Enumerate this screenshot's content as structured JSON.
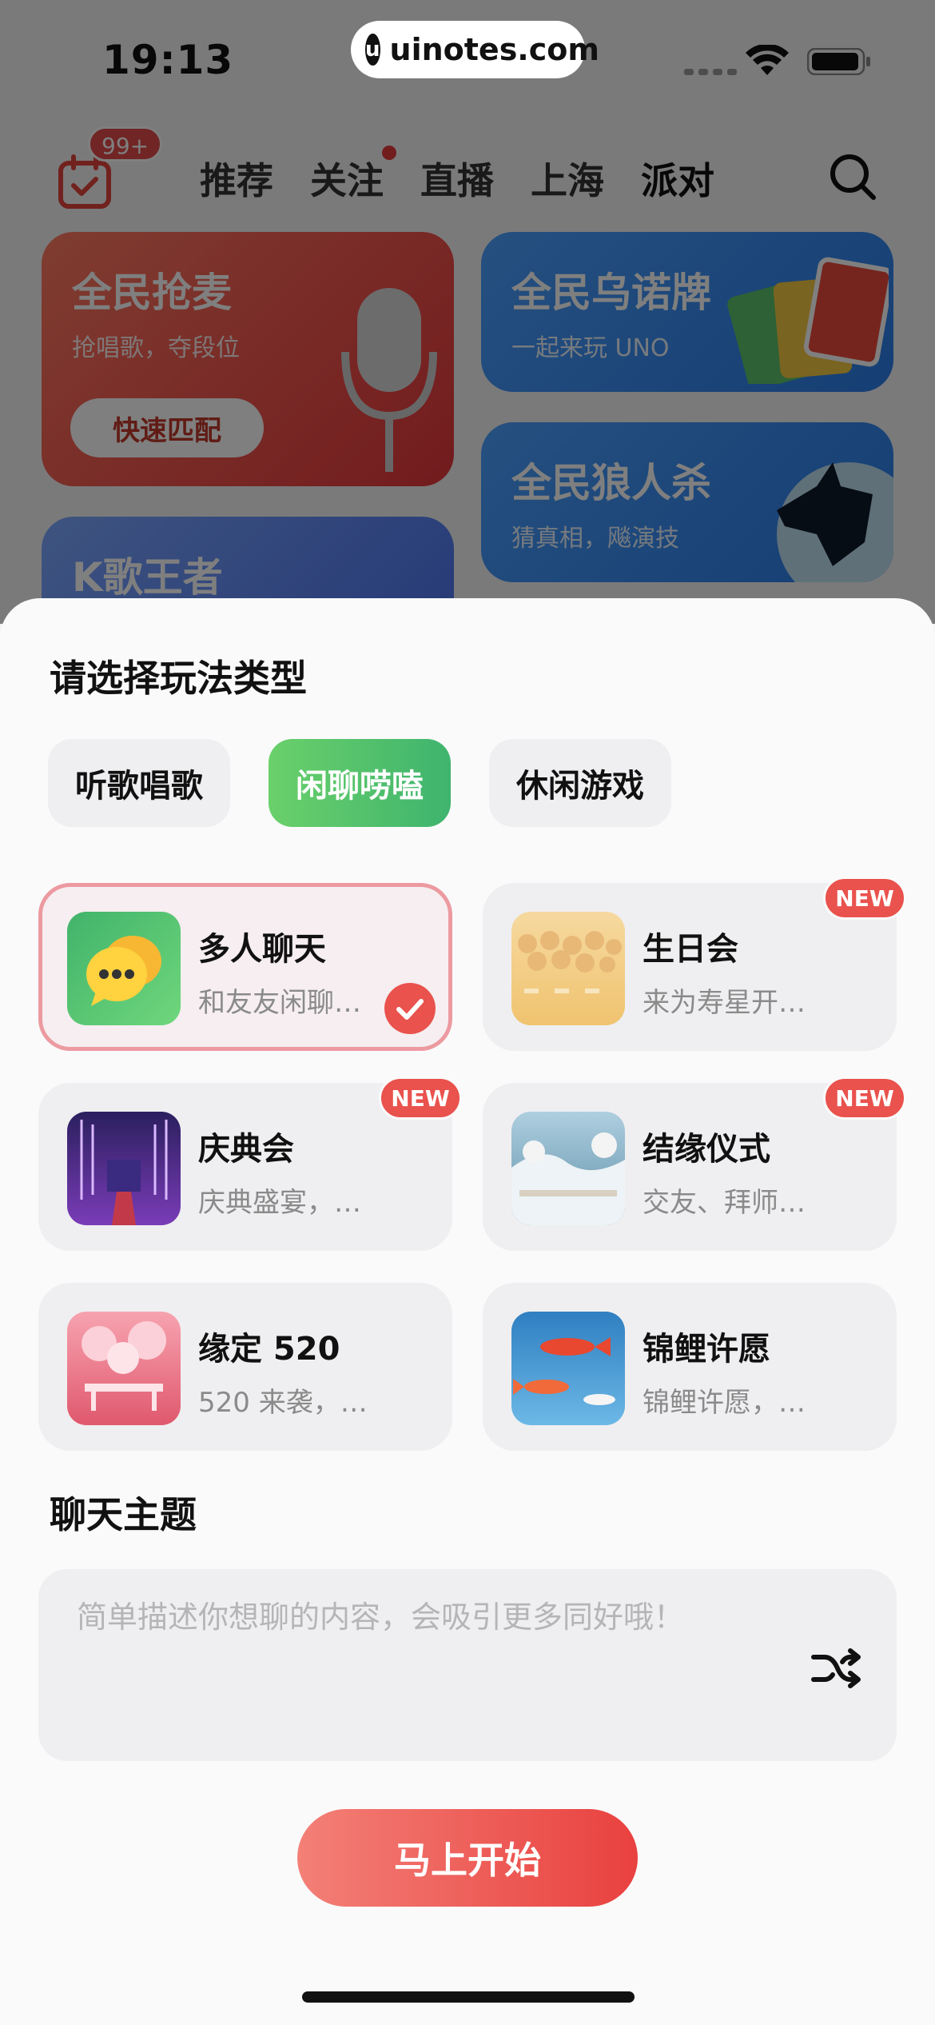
{
  "status_bar": {
    "time": "19:13",
    "watermark": "uinotes.com",
    "watermark_logo": "u"
  },
  "nav": {
    "badge": "99+",
    "tabs": [
      {
        "label": "推荐",
        "dot": false
      },
      {
        "label": "关注",
        "dot": true
      },
      {
        "label": "直播",
        "dot": false
      },
      {
        "label": "上海",
        "dot": false
      },
      {
        "label": "派对",
        "dot": false,
        "active": true
      }
    ]
  },
  "background_cards": {
    "card_a": {
      "title": "全民抢麦",
      "subtitle": "抢唱歌，夺段位",
      "button": "快速匹配"
    },
    "card_b": {
      "title": "全民乌诺牌",
      "subtitle": "一起来玩 UNO"
    },
    "card_c": {
      "title": "全民狼人杀",
      "subtitle": "猜真相，飚演技"
    },
    "card_d": {
      "title": "K歌王者"
    }
  },
  "sheet": {
    "title": "请选择玩法类型",
    "types": [
      {
        "label": "听歌唱歌",
        "active": false
      },
      {
        "label": "闲聊唠嗑",
        "active": true
      },
      {
        "label": "休闲游戏",
        "active": false
      }
    ],
    "modes": [
      {
        "name": "多人聊天",
        "desc": "和友友闲聊…",
        "new": false,
        "selected": true,
        "icon": "chat-bubbles-icon"
      },
      {
        "name": "生日会",
        "desc": "来为寿星开…",
        "new": true,
        "new_label": "NEW",
        "selected": false,
        "icon": "birthday-thumb"
      },
      {
        "name": "庆典会",
        "desc": "庆典盛宴，…",
        "new": true,
        "new_label": "NEW",
        "selected": false,
        "icon": "celebration-thumb"
      },
      {
        "name": "结缘仪式",
        "desc": "交友、拜师…",
        "new": true,
        "new_label": "NEW",
        "selected": false,
        "icon": "ceremony-thumb"
      },
      {
        "name": "缘定 520",
        "desc": "520 来袭，…",
        "new": false,
        "selected": false,
        "icon": "love-520-thumb"
      },
      {
        "name": "锦鲤许愿",
        "desc": "锦鲤许愿，…",
        "new": false,
        "selected": false,
        "icon": "koi-thumb"
      }
    ],
    "topic_title": "聊天主题",
    "topic_placeholder": "简单描述你想聊的内容，会吸引更多同好哦！",
    "start_button": "马上开始"
  },
  "colors": {
    "accent_red": "#e9413f",
    "active_green": "#3fb46e",
    "new_badge": "#e9524d"
  }
}
